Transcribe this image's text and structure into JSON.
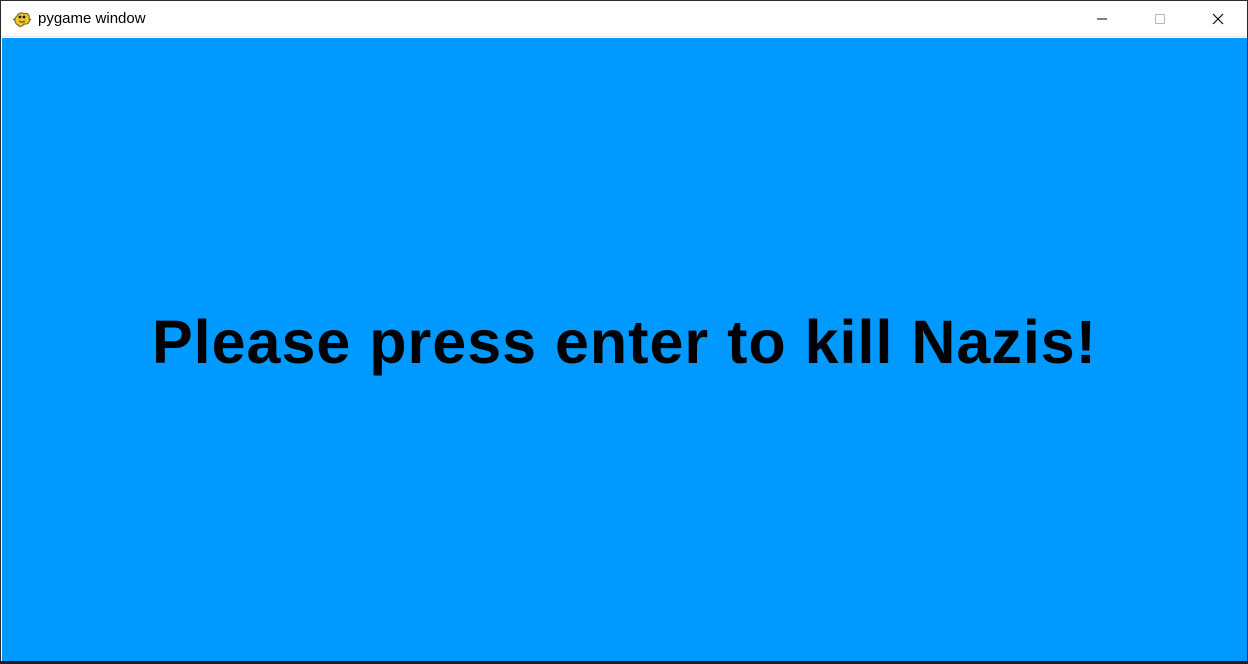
{
  "window": {
    "title": "pygame window",
    "app_icon": "pygame-snake-icon",
    "controls": {
      "minimize_icon": "minimize-icon",
      "maximize_icon": "maximize-icon",
      "close_icon": "close-icon"
    }
  },
  "game": {
    "background_color": "#0099ff",
    "text_color": "#000000",
    "prompt_text": "Please press enter to kill Nazis!"
  }
}
